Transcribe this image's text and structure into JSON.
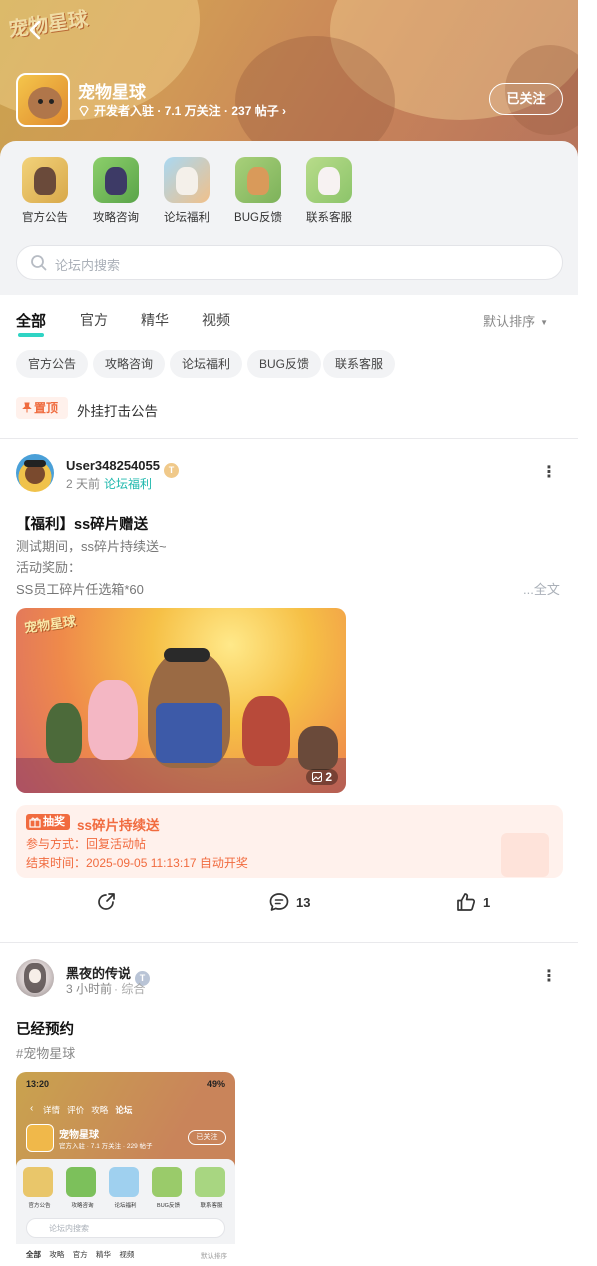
{
  "header": {
    "logo_text": "宠物星球",
    "back_label": "‹",
    "forum_name": "宠物星球",
    "meta": "开发者入驻 · 7.1 万关注 · 237 帖子",
    "meta_arrow": "›",
    "follow_label": "已关注"
  },
  "categories": [
    {
      "label": "官方公告",
      "color": "#e9c66a"
    },
    {
      "label": "攻略咨询",
      "color": "#7cc05b"
    },
    {
      "label": "论坛福利",
      "color": "#9fd0ef"
    },
    {
      "label": "BUG反馈",
      "color": "#9acb6a"
    },
    {
      "label": "联系客服",
      "color": "#a8d681"
    }
  ],
  "search": {
    "placeholder": "论坛内搜索"
  },
  "tabs": [
    {
      "label": "全部"
    },
    {
      "label": "官方"
    },
    {
      "label": "精华"
    },
    {
      "label": "视频"
    }
  ],
  "sort": {
    "label": "默认排序"
  },
  "chips": [
    {
      "label": "官方公告"
    },
    {
      "label": "攻略咨询"
    },
    {
      "label": "论坛福利"
    },
    {
      "label": "BUG反馈"
    },
    {
      "label": "联系客服"
    }
  ],
  "pinned": {
    "badge": "置顶",
    "text": "外挂打击公告"
  },
  "post1": {
    "username": "User348254055",
    "time": "2 天前",
    "tag": "论坛福利",
    "title": "【福利】ss碎片赠送",
    "lines": [
      "测试期间，ss碎片持续送~",
      "活动奖励：",
      "SS员工碎片任选箱*60"
    ],
    "fulltext": "...全文",
    "image_count": "2",
    "logo_text": "宠物星球",
    "lottery": {
      "badge": "抽奖",
      "title": "ss碎片持续送",
      "line1": "参与方式：回复活动帖",
      "line2": "结束时间：2025-09-05 11:13:17 自动开奖"
    },
    "comments": "13",
    "likes": "1"
  },
  "post2": {
    "username": "黑夜的传说",
    "time": "3 小时前",
    "tag": "· 综合",
    "title": "已经预约",
    "hashtag": "#宠物星球",
    "screenshot": {
      "status_time": "13:20",
      "battery": "49%",
      "tabs": [
        "详情",
        "评价",
        "攻略",
        "论坛"
      ],
      "forum_name": "宠物星球",
      "meta": "官方入驻 · 7.1 万关注 · 229 帖子",
      "follow": "已关注",
      "cats": [
        "官方公告",
        "攻略咨询",
        "论坛福利",
        "BUG反馈",
        "联系客服"
      ],
      "search": "论坛内搜索",
      "subtabs": [
        "全部",
        "攻略",
        "官方",
        "精华",
        "视频"
      ],
      "sort": "默认排序"
    }
  }
}
